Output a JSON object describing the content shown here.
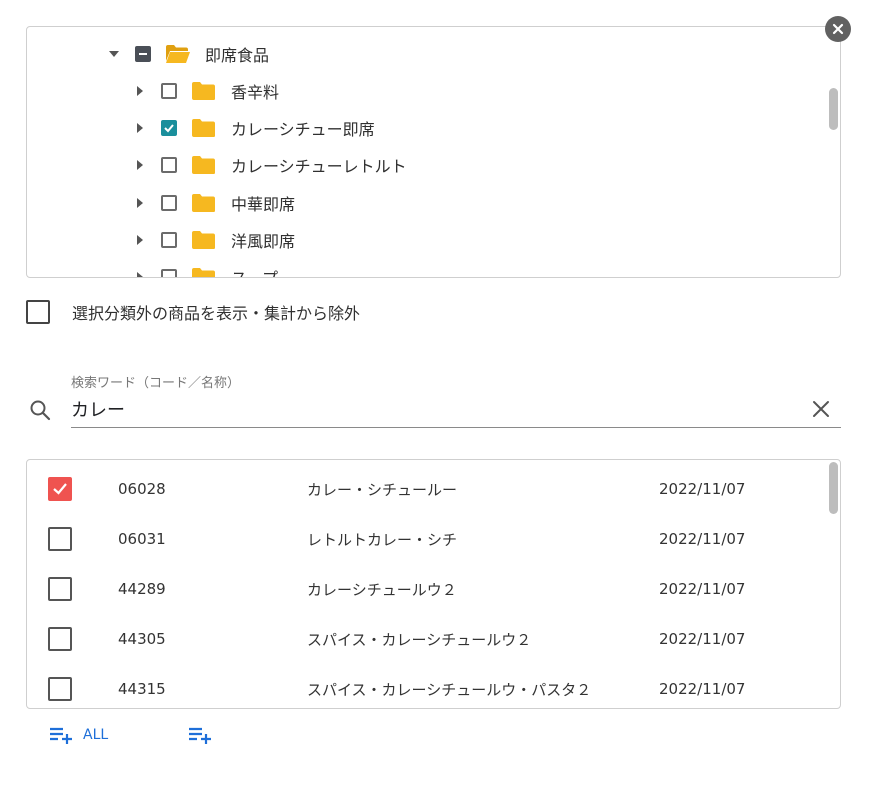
{
  "tree": {
    "root": {
      "label": "即席食品",
      "state": "indeterminate",
      "expanded": true
    },
    "children": [
      {
        "label": "香辛料",
        "checked": false
      },
      {
        "label": "カレーシチュー即席",
        "checked": true
      },
      {
        "label": "カレーシチューレトルト",
        "checked": false
      },
      {
        "label": "中華即席",
        "checked": false
      },
      {
        "label": "洋風即席",
        "checked": false
      },
      {
        "label": "スープ",
        "checked": false
      }
    ]
  },
  "exclude_option": {
    "label": "選択分類外の商品を表示・集計から除外",
    "checked": false
  },
  "search": {
    "caption": "検索ワード（コード／名称）",
    "value": "カレー"
  },
  "results": [
    {
      "code": "06028",
      "name": "カレー・シチュールー",
      "date": "2022/11/07",
      "checked": true
    },
    {
      "code": "06031",
      "name": "レトルトカレー・シチ",
      "date": "2022/11/07",
      "checked": false
    },
    {
      "code": "44289",
      "name": "カレーシチュールウ２",
      "date": "2022/11/07",
      "checked": false
    },
    {
      "code": "44305",
      "name": "スパイス・カレーシチュールウ２",
      "date": "2022/11/07",
      "checked": false
    },
    {
      "code": "44315",
      "name": "スパイス・カレーシチュールウ・パスタ２",
      "date": "2022/11/07",
      "checked": false
    }
  ],
  "actions": {
    "add_all_label": "ALL"
  },
  "colors": {
    "folder": "#f6b820",
    "checked_teal": "#1a8f9c",
    "checked_red": "#ef5350",
    "accent_blue": "#1e6fd9"
  },
  "icons": {
    "close": "close-circle-icon",
    "folder_open": "folder-open-icon",
    "folder": "folder-icon",
    "search": "search-icon",
    "clear": "close-icon",
    "add_list": "playlist-add-icon"
  }
}
